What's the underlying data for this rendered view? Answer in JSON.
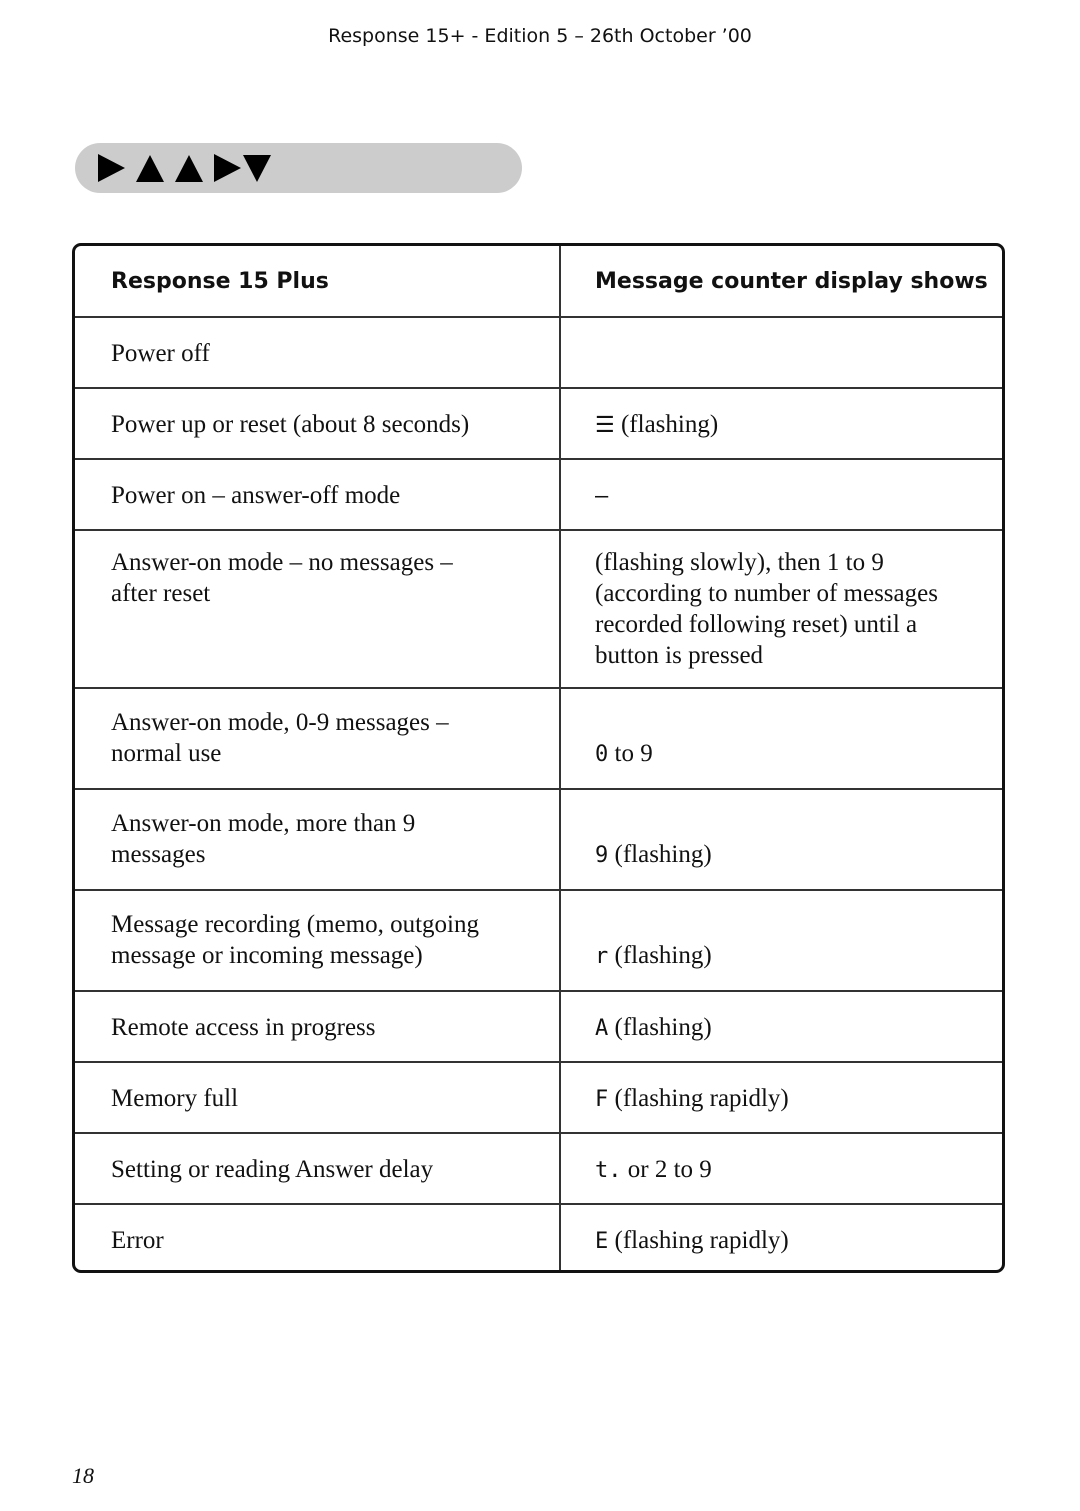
{
  "header": {
    "text": "Response 15+ - Edition 5 – 26th October ’00"
  },
  "nav_bar": {
    "icons": [
      "arrow-right-icon",
      "arrow-up-icon",
      "arrow-up-icon",
      "arrow-right-icon",
      "arrow-down-icon"
    ]
  },
  "table": {
    "headers": [
      "Response 15 Plus",
      "Message counter display shows"
    ],
    "rows": [
      {
        "state": "Power off",
        "display": "",
        "display_prefix": ""
      },
      {
        "state": "Power up or reset (about 8 seconds)",
        "display_prefix": "☰",
        "display": "(flashing)"
      },
      {
        "state": "Power on – answer-off mode",
        "display_prefix": "–",
        "display": ""
      },
      {
        "state": "Answer-on mode – no messages – after reset",
        "display_prefix": "",
        "display": "(flashing slowly), then 1 to 9 (according to number of messages recorded following reset) until a button is pressed"
      },
      {
        "state": "Answer-on mode, 0-9 messages – normal use",
        "display_prefix": "0",
        "display": "to 9"
      },
      {
        "state": "Answer-on mode, more than 9 messages",
        "display_prefix": "9",
        "display": "(flashing)"
      },
      {
        "state": "Message recording (memo, outgoing message or incoming message)",
        "display_prefix": "r",
        "display": "(flashing)"
      },
      {
        "state": "Remote access in progress",
        "display_prefix": "A",
        "display": "(flashing)"
      },
      {
        "state": "Memory full",
        "display_prefix": "F",
        "display": "(flashing rapidly)"
      },
      {
        "state": "Setting or reading Answer delay",
        "display_prefix": "t.",
        "display": "or 2 to 9"
      },
      {
        "state": "Error",
        "display_prefix": "E",
        "display": "(flashing rapidly)"
      }
    ]
  },
  "footer": {
    "page_number": "18"
  }
}
